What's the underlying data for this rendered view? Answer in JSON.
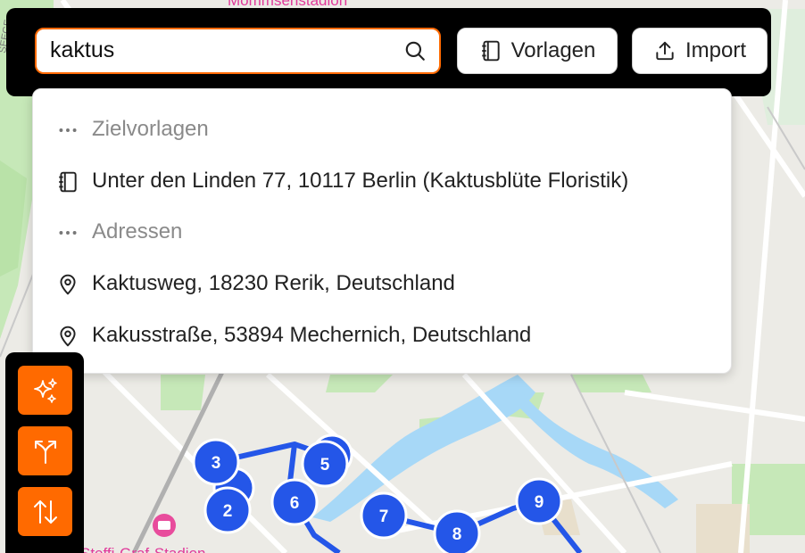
{
  "map": {
    "labels": {
      "top": "Mommsenstadion",
      "bottom": "Steffi-Graf-Stadion",
      "left_edge": "SEEGE"
    },
    "stops": [
      "2",
      "3",
      "5",
      "6",
      "7",
      "8",
      "9"
    ],
    "route_color": "#2456e8"
  },
  "search": {
    "value": "kaktus",
    "placeholder": ""
  },
  "toolbar": {
    "templates_label": "Vorlagen",
    "import_label": "Import"
  },
  "dropdown": {
    "templates_header": "Zielvorlagen",
    "template_item": "Unter den Linden 77, 10117 Berlin (Kaktusblüte Floristik)",
    "addresses_header": "Adressen",
    "address_items": [
      "Kaktusweg, 18230 Rerik, Deutschland",
      "Kakusstraße, 53894 Mechernich, Deutschland"
    ]
  },
  "icons": {
    "search": "search-icon",
    "templates": "notebook-icon",
    "import": "upload-icon",
    "more": "more-dots-icon",
    "pin": "map-pin-icon",
    "sparkles": "sparkles-icon",
    "split": "split-route-icon",
    "swap": "swap-vertical-icon"
  },
  "colors": {
    "accent": "#ff6a00",
    "toolbar_bg": "#000000",
    "park": "#c6e8b8",
    "water": "#a7d8f7"
  }
}
